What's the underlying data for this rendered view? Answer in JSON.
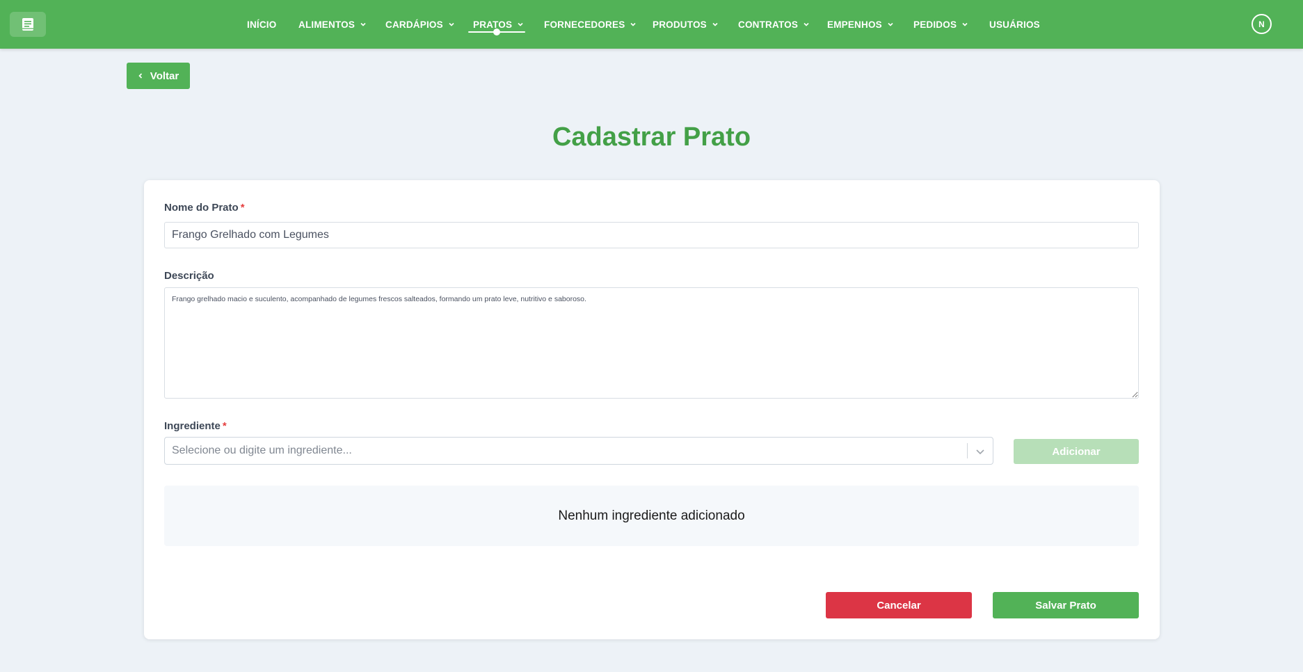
{
  "nav": {
    "items": [
      {
        "label": "INÍCIO",
        "dropdown": false
      },
      {
        "label": "ALIMENTOS",
        "dropdown": true
      },
      {
        "label": "CARDÁPIOS",
        "dropdown": true
      },
      {
        "label": "PRATOS",
        "dropdown": true,
        "active": true
      },
      {
        "label": "FORNECEDORES",
        "dropdown": true
      },
      {
        "label": "PRODUTOS",
        "dropdown": true
      },
      {
        "label": "CONTRATOS",
        "dropdown": true
      },
      {
        "label": "EMPENHOS",
        "dropdown": true
      },
      {
        "label": "PEDIDOS",
        "dropdown": true
      },
      {
        "label": "USUÁRIOS",
        "dropdown": false
      }
    ],
    "avatar_initial": "N",
    "logo_icon": "book-icon"
  },
  "back_button": {
    "label": "Voltar",
    "icon": "chevron-left-icon"
  },
  "page_title": "Cadastrar Prato",
  "form": {
    "name": {
      "label": "Nome do Prato",
      "required_mark": "*",
      "value": "Frango Grelhado com Legumes"
    },
    "description": {
      "label": "Descrição",
      "value": "Frango grelhado macio e suculento, acompanhado de legumes frescos salteados, formando um prato leve, nutritivo e saboroso."
    },
    "ingredient": {
      "label": "Ingrediente",
      "required_mark": "*",
      "placeholder": "Selecione ou digite um ingrediente...",
      "add_label": "Adicionar"
    },
    "empty_ingredients": "Nenhum ingrediente adicionado",
    "cancel_label": "Cancelar",
    "save_label": "Salvar Prato"
  },
  "colors": {
    "brand_green": "#52b257",
    "title_green": "#43a047",
    "danger_red": "#dc3545",
    "disabled_green": "#b7dfb8",
    "background": "#edf2f7"
  }
}
